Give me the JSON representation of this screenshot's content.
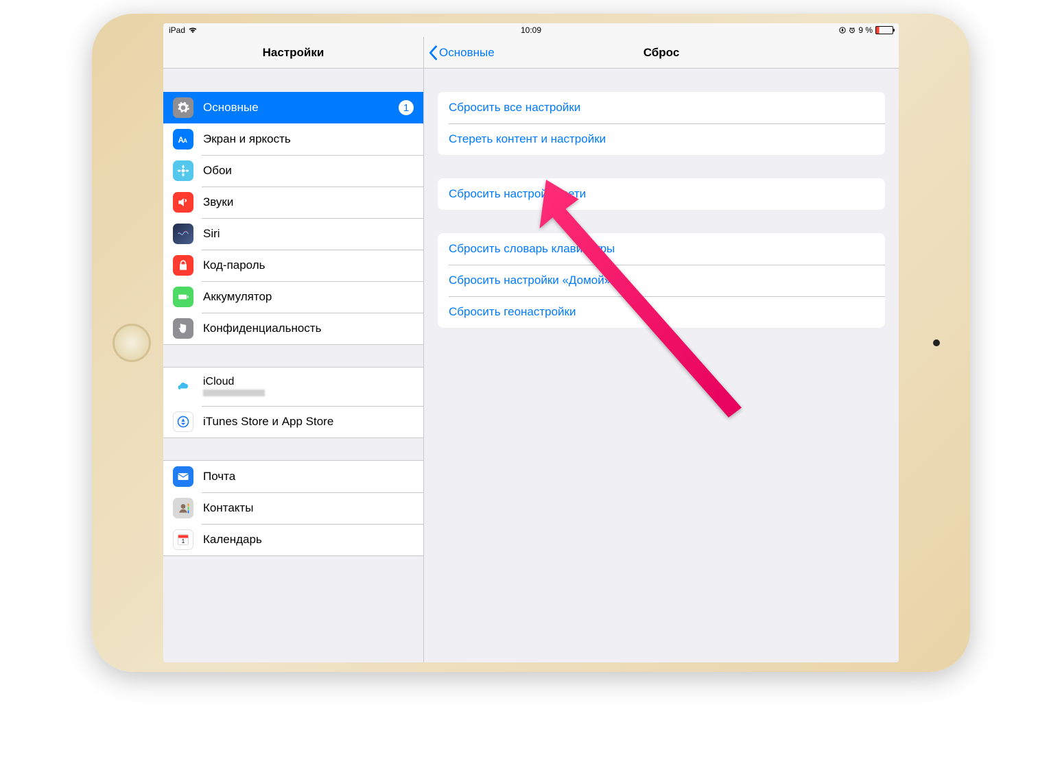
{
  "statusbar": {
    "device": "iPad",
    "time": "10:09",
    "battery": "9 %"
  },
  "sidebar": {
    "title": "Настройки",
    "groups": [
      [
        {
          "key": "general",
          "label": "Основные",
          "badge": "1",
          "selected": true
        },
        {
          "key": "display",
          "label": "Экран и яркость"
        },
        {
          "key": "wallpaper",
          "label": "Обои"
        },
        {
          "key": "sounds",
          "label": "Звуки"
        },
        {
          "key": "siri",
          "label": "Siri"
        },
        {
          "key": "passcode",
          "label": "Код-пароль"
        },
        {
          "key": "battery",
          "label": "Аккумулятор"
        },
        {
          "key": "privacy",
          "label": "Конфиденциальность"
        }
      ],
      [
        {
          "key": "icloud",
          "label": "iCloud",
          "sub": ""
        },
        {
          "key": "appstore",
          "label": "iTunes Store и App Store"
        }
      ],
      [
        {
          "key": "mail",
          "label": "Почта"
        },
        {
          "key": "contacts",
          "label": "Контакты"
        },
        {
          "key": "calendar",
          "label": "Календарь"
        }
      ]
    ]
  },
  "detail": {
    "back": "Основные",
    "title": "Сброс",
    "groups": [
      [
        "Сбросить все настройки",
        "Стереть контент и настройки"
      ],
      [
        "Сбросить настройки сети"
      ],
      [
        "Сбросить словарь клавиатуры",
        "Сбросить настройки «Домой»",
        "Сбросить геонастройки"
      ]
    ]
  }
}
